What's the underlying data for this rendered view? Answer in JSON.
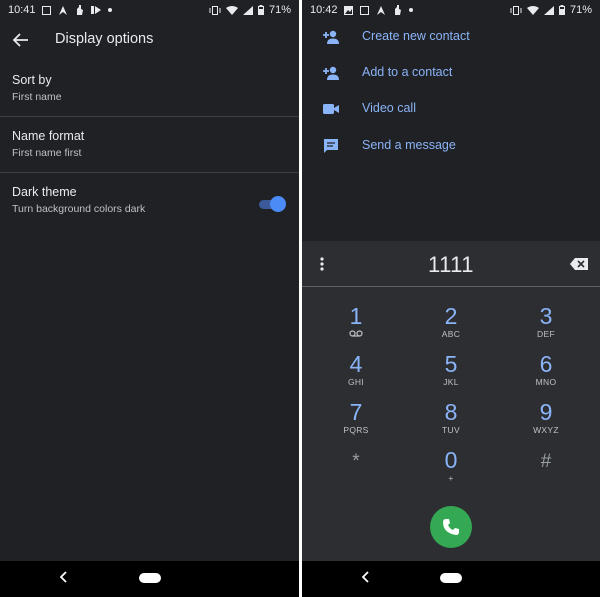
{
  "left_screen": {
    "status": {
      "time": "10:41",
      "battery": "71%"
    },
    "header": {
      "title": "Display options"
    },
    "prefs": [
      {
        "title": "Sort by",
        "summary": "First name"
      },
      {
        "title": "Name format",
        "summary": "First name first"
      },
      {
        "title": "Dark theme",
        "summary": "Turn background colors dark",
        "toggle_on": true
      }
    ]
  },
  "right_screen": {
    "status": {
      "time": "10:42",
      "battery": "71%"
    },
    "actions": [
      {
        "label": "Create new contact",
        "icon": "person-add-icon"
      },
      {
        "label": "Add to a contact",
        "icon": "person-add-icon"
      },
      {
        "label": "Video call",
        "icon": "videocam-icon"
      },
      {
        "label": "Send a message",
        "icon": "message-icon"
      }
    ],
    "dialed_number": "1111",
    "keys": [
      {
        "digit": "1",
        "letters": ""
      },
      {
        "digit": "2",
        "letters": "ABC"
      },
      {
        "digit": "3",
        "letters": "DEF"
      },
      {
        "digit": "4",
        "letters": "GHI"
      },
      {
        "digit": "5",
        "letters": "JKL"
      },
      {
        "digit": "6",
        "letters": "MNO"
      },
      {
        "digit": "7",
        "letters": "PQRS"
      },
      {
        "digit": "8",
        "letters": "TUV"
      },
      {
        "digit": "9",
        "letters": "WXYZ"
      },
      {
        "digit": "*",
        "letters": ""
      },
      {
        "digit": "0",
        "letters": "+"
      },
      {
        "digit": "#",
        "letters": ""
      }
    ]
  },
  "colors": {
    "background": "#202124",
    "accent": "#8ab4f8",
    "call_button": "#34a853",
    "toggle_on": "#4b8bf5"
  }
}
